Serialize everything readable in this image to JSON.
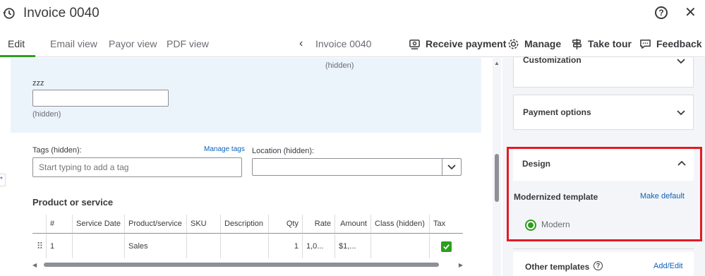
{
  "window": {
    "title": "Invoice 0040",
    "help_icon_glyph": "?",
    "close_icon_glyph": "✕"
  },
  "nav": {
    "tabs": [
      {
        "label": "Edit",
        "active": true
      },
      {
        "label": "Email view",
        "active": false
      },
      {
        "label": "Payor view",
        "active": false
      },
      {
        "label": "PDF view",
        "active": false
      }
    ],
    "prev_glyph": "‹",
    "current_invoice": "Invoice 0040",
    "actions": [
      {
        "label": "Receive payment",
        "icon": "receive-payment-icon"
      },
      {
        "label": "Manage",
        "icon": "gear-icon"
      },
      {
        "label": "Take tour",
        "icon": "signpost-icon"
      },
      {
        "label": "Feedback",
        "icon": "chat-icon"
      }
    ]
  },
  "form": {
    "hidden_top": "(hidden)",
    "custom_field_label": "zzz",
    "custom_field_value": "",
    "hidden_mid": "(hidden)",
    "tags_label": "Tags (hidden):",
    "manage_tags": "Manage tags",
    "tags_placeholder": "Start typing to add a tag",
    "location_label": "Location (hidden):",
    "location_value": "",
    "section_title": "Product or service"
  },
  "table": {
    "columns": [
      "",
      "#",
      "Service Date",
      "Product/service",
      "SKU",
      "Description",
      "Qty",
      "Rate",
      "Amount",
      "Class (hidden)",
      "Tax"
    ],
    "rows": [
      {
        "drag": "⠿",
        "num": "1",
        "service_date": "",
        "product": "Sales",
        "sku": "",
        "description": "",
        "qty": "1",
        "rate": "1,0...",
        "amount": "$1,...",
        "class": "",
        "tax_checked": true
      }
    ]
  },
  "sidebar": {
    "customization": "Customization",
    "payment_options": "Payment options",
    "design": {
      "title": "Design",
      "template_heading": "Modernized template",
      "make_default": "Make default",
      "selected_template": "Modern"
    },
    "other_templates": "Other templates",
    "info_glyph": "?",
    "add_edit": "Add/Edit"
  },
  "colors": {
    "accent_green": "#2ca01c",
    "link_blue": "#0d61b8",
    "highlight_red": "#e21b25",
    "panel_blue": "#ecf4fb"
  }
}
